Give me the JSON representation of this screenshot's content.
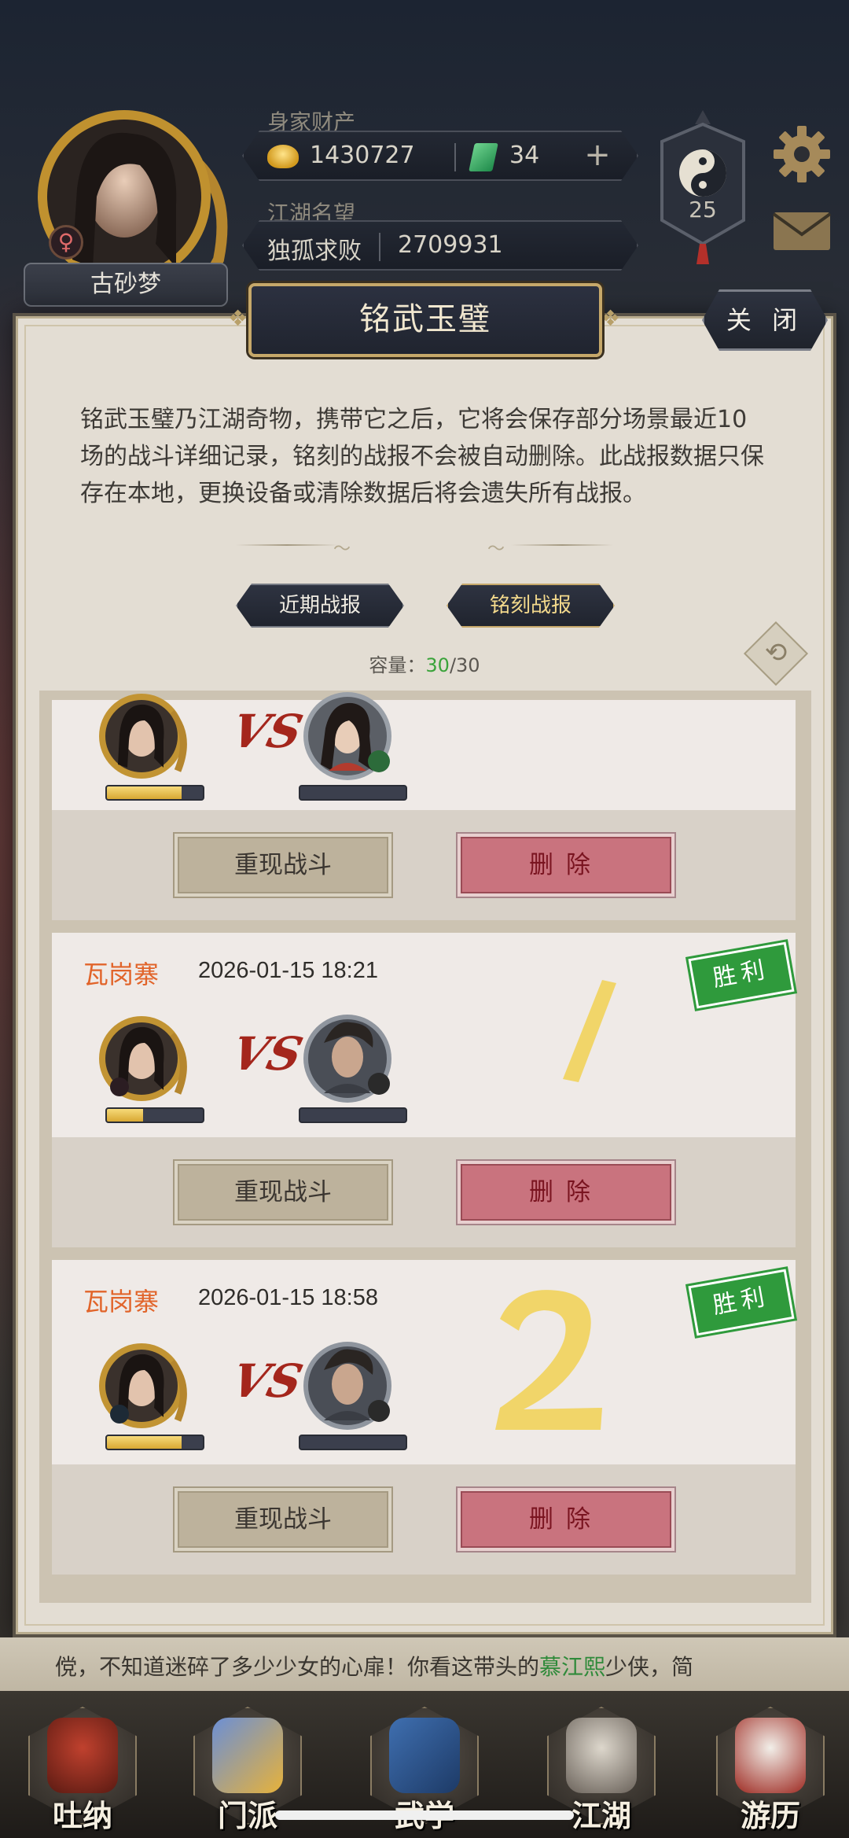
{
  "player": {
    "name": "古砂梦",
    "gender_symbol": "♀"
  },
  "wealth": {
    "label": "身家财产",
    "gold": "1430727",
    "jade": "34",
    "plus": "+"
  },
  "fame": {
    "label": "江湖名望",
    "title": "独孤求败",
    "value": "2709931"
  },
  "level": "25",
  "modal": {
    "title": "铭武玉璧",
    "close_label": "关 闭",
    "description": "铭武玉璧乃江湖奇物，携带它之后，它将会保存部分场景最近10场的战斗详细记录，铭刻的战报不会被自动删除。此战报数据只保存在本地，更换设备或清除数据后将会遗失所有战报。",
    "tabs": [
      {
        "label": "近期战报"
      },
      {
        "label": "铭刻战报"
      }
    ],
    "capacity_label": "容量：",
    "capacity_used": "30",
    "capacity_total": "/30"
  },
  "reports": [
    {
      "place": "",
      "time": "",
      "result": "",
      "vs": "VS",
      "hero_gender": "♀",
      "hero_hp": 0.78,
      "replay_label": "重现战斗",
      "delete_label": "删除"
    },
    {
      "place": "瓦岗寨",
      "time": "2026-01-15 18:21",
      "result": "胜利",
      "vs": "VS",
      "hero_gender": "♀",
      "hero_hp": 0.38,
      "replay_label": "重现战斗",
      "delete_label": "删除"
    },
    {
      "place": "瓦岗寨",
      "time": "2026-01-15 18:58",
      "result": "胜利",
      "vs": "VS",
      "hero_gender": "♂",
      "hero_hp": 0.78,
      "replay_label": "重现战斗",
      "delete_label": "删除"
    }
  ],
  "story": {
    "line_start": "傥，不知道迷碎了多少少女的心扉！你看这带头的",
    "highlight": "慕江熙",
    "line_end": "少侠，简"
  },
  "bottom_nav": [
    {
      "label": "吐纳",
      "icon": "meditation-icon"
    },
    {
      "label": "门派",
      "icon": "sect-icon"
    },
    {
      "label": "武学",
      "icon": "martial-arts-icon"
    },
    {
      "label": "江湖",
      "icon": "jianghu-icon"
    },
    {
      "label": "游历",
      "icon": "travel-icon"
    }
  ],
  "colors": {
    "place": "#e1642a",
    "victory": "#2f9a3c",
    "capacity_used": "#3aa33a",
    "delete": "#c9737e"
  }
}
